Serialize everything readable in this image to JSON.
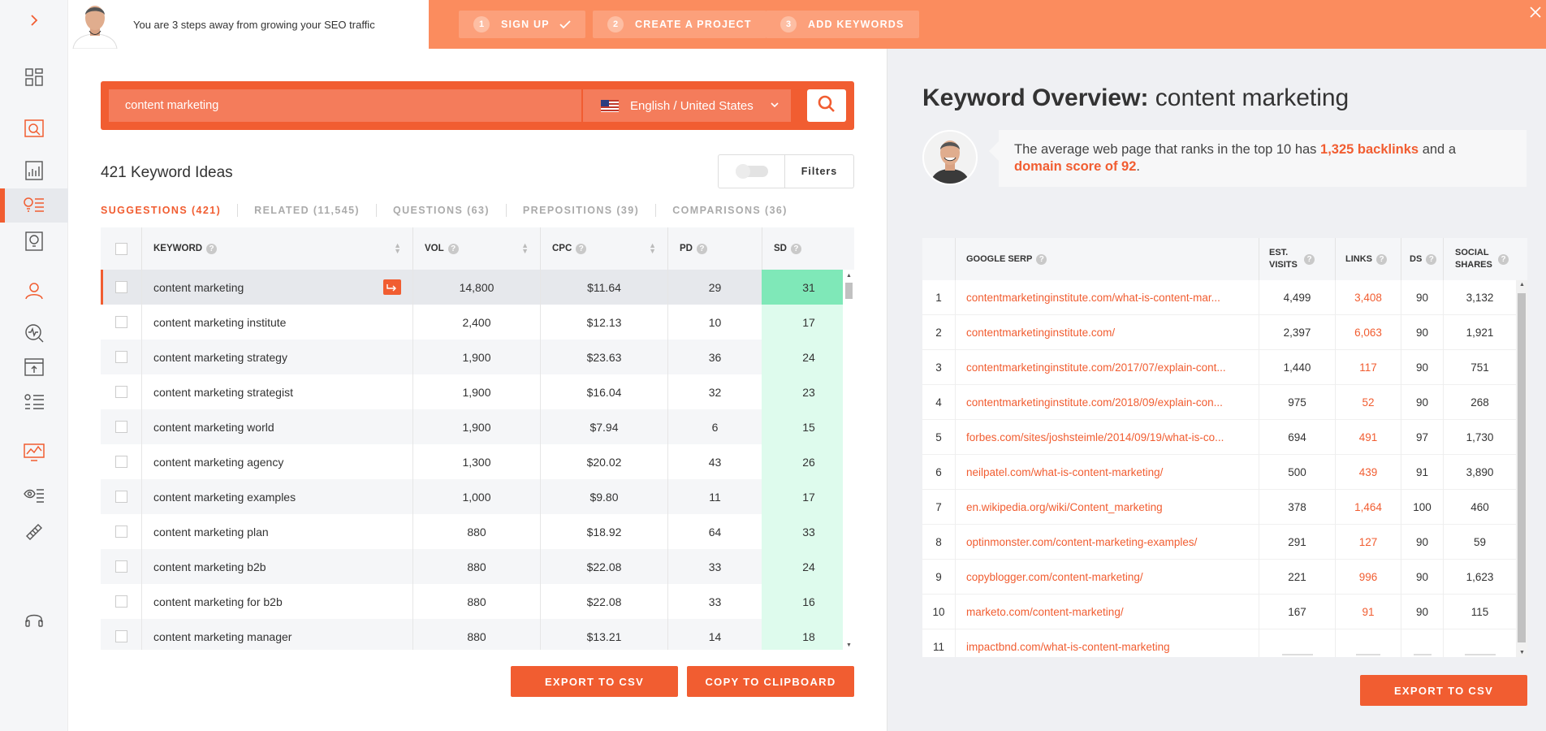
{
  "banner": {
    "message": "You are 3 steps away from growing your SEO traffic",
    "steps": [
      {
        "num": "1",
        "label": "SIGN UP",
        "done": true
      },
      {
        "num": "2",
        "label": "CREATE A PROJECT",
        "done": false
      },
      {
        "num": "3",
        "label": "ADD KEYWORDS",
        "done": false
      }
    ],
    "close_icon": "close-icon"
  },
  "sidebar": {
    "icons": [
      "expand-arrow-icon",
      "dashboard-icon",
      "site-audit-icon",
      "traffic-analyzer-icon",
      "keyword-ideas-icon",
      "content-ideas-icon",
      "backlinks-icon",
      "rank-tracker-icon",
      "chrome-extension-icon",
      "keyword-lists-icon",
      "traffic-icon",
      "ai-writer-icon",
      "link-icon",
      "support-headset-icon"
    ],
    "active": "keyword-ideas-icon"
  },
  "search": {
    "value": "content marketing",
    "language": "English / United States"
  },
  "ideas": {
    "title": "421 Keyword Ideas",
    "filters_label": "Filters",
    "tabs": [
      "SUGGESTIONS (421)",
      "RELATED (11,545)",
      "QUESTIONS (63)",
      "PREPOSITIONS (39)",
      "COMPARISONS (36)"
    ],
    "active_tab": 0,
    "columns": [
      "KEYWORD",
      "VOL",
      "CPC",
      "PD",
      "SD"
    ],
    "rows": [
      {
        "keyword": "content marketing",
        "vol": "14,800",
        "cpc": "$11.64",
        "pd": "29",
        "sd": "31"
      },
      {
        "keyword": "content marketing institute",
        "vol": "2,400",
        "cpc": "$12.13",
        "pd": "10",
        "sd": "17"
      },
      {
        "keyword": "content marketing strategy",
        "vol": "1,900",
        "cpc": "$23.63",
        "pd": "36",
        "sd": "24"
      },
      {
        "keyword": "content marketing strategist",
        "vol": "1,900",
        "cpc": "$16.04",
        "pd": "32",
        "sd": "23"
      },
      {
        "keyword": "content marketing world",
        "vol": "1,900",
        "cpc": "$7.94",
        "pd": "6",
        "sd": "15"
      },
      {
        "keyword": "content marketing agency",
        "vol": "1,300",
        "cpc": "$20.02",
        "pd": "43",
        "sd": "26"
      },
      {
        "keyword": "content marketing examples",
        "vol": "1,000",
        "cpc": "$9.80",
        "pd": "11",
        "sd": "17"
      },
      {
        "keyword": "content marketing plan",
        "vol": "880",
        "cpc": "$18.92",
        "pd": "64",
        "sd": "33"
      },
      {
        "keyword": "content marketing b2b",
        "vol": "880",
        "cpc": "$22.08",
        "pd": "33",
        "sd": "24"
      },
      {
        "keyword": "content marketing for b2b",
        "vol": "880",
        "cpc": "$22.08",
        "pd": "33",
        "sd": "16"
      },
      {
        "keyword": "content marketing manager",
        "vol": "880",
        "cpc": "$13.21",
        "pd": "14",
        "sd": "18"
      }
    ],
    "export_label": "EXPORT TO CSV",
    "copy_label": "COPY TO CLIPBOARD"
  },
  "overview": {
    "title_bold": "Keyword Overview:",
    "title_kw": "content marketing",
    "tip_pre": "The average web page that ranks in the top 10 has",
    "tip_backlinks": "1,325 backlinks",
    "tip_mid": "and a",
    "tip_domain": "domain score of 92",
    "tip_end": ".",
    "columns": [
      "GOOGLE SERP",
      "EST. VISITS",
      "LINKS",
      "DS",
      "SOCIAL SHARES"
    ],
    "rows": [
      {
        "rank": "1",
        "url": "contentmarketinginstitute.com/what-is-content-mar...",
        "visits": "4,499",
        "links": "3,408",
        "ds": "90",
        "shares": "3,132"
      },
      {
        "rank": "2",
        "url": "contentmarketinginstitute.com/",
        "visits": "2,397",
        "links": "6,063",
        "ds": "90",
        "shares": "1,921"
      },
      {
        "rank": "3",
        "url": "contentmarketinginstitute.com/2017/07/explain-cont...",
        "visits": "1,440",
        "links": "117",
        "ds": "90",
        "shares": "751"
      },
      {
        "rank": "4",
        "url": "contentmarketinginstitute.com/2018/09/explain-con...",
        "visits": "975",
        "links": "52",
        "ds": "90",
        "shares": "268"
      },
      {
        "rank": "5",
        "url": "forbes.com/sites/joshsteimle/2014/09/19/what-is-co...",
        "visits": "694",
        "links": "491",
        "ds": "97",
        "shares": "1,730"
      },
      {
        "rank": "6",
        "url": "neilpatel.com/what-is-content-marketing/",
        "visits": "500",
        "links": "439",
        "ds": "91",
        "shares": "3,890"
      },
      {
        "rank": "7",
        "url": "en.wikipedia.org/wiki/Content_marketing",
        "visits": "378",
        "links": "1,464",
        "ds": "100",
        "shares": "460"
      },
      {
        "rank": "8",
        "url": "optinmonster.com/content-marketing-examples/",
        "visits": "291",
        "links": "127",
        "ds": "90",
        "shares": "59"
      },
      {
        "rank": "9",
        "url": "copyblogger.com/content-marketing/",
        "visits": "221",
        "links": "996",
        "ds": "90",
        "shares": "1,623"
      },
      {
        "rank": "10",
        "url": "marketo.com/content-marketing/",
        "visits": "167",
        "links": "91",
        "ds": "90",
        "shares": "115"
      },
      {
        "rank": "11",
        "url": "impactbnd.com/what-is-content-marketing",
        "visits": "",
        "links": "",
        "ds": "",
        "shares": ""
      }
    ],
    "export_label": "EXPORT TO CSV"
  },
  "colors": {
    "accent": "#f15d31",
    "banner": "#fb8c5e",
    "sd_easy": "#defbed",
    "sd_selected": "#7fe8b8"
  }
}
